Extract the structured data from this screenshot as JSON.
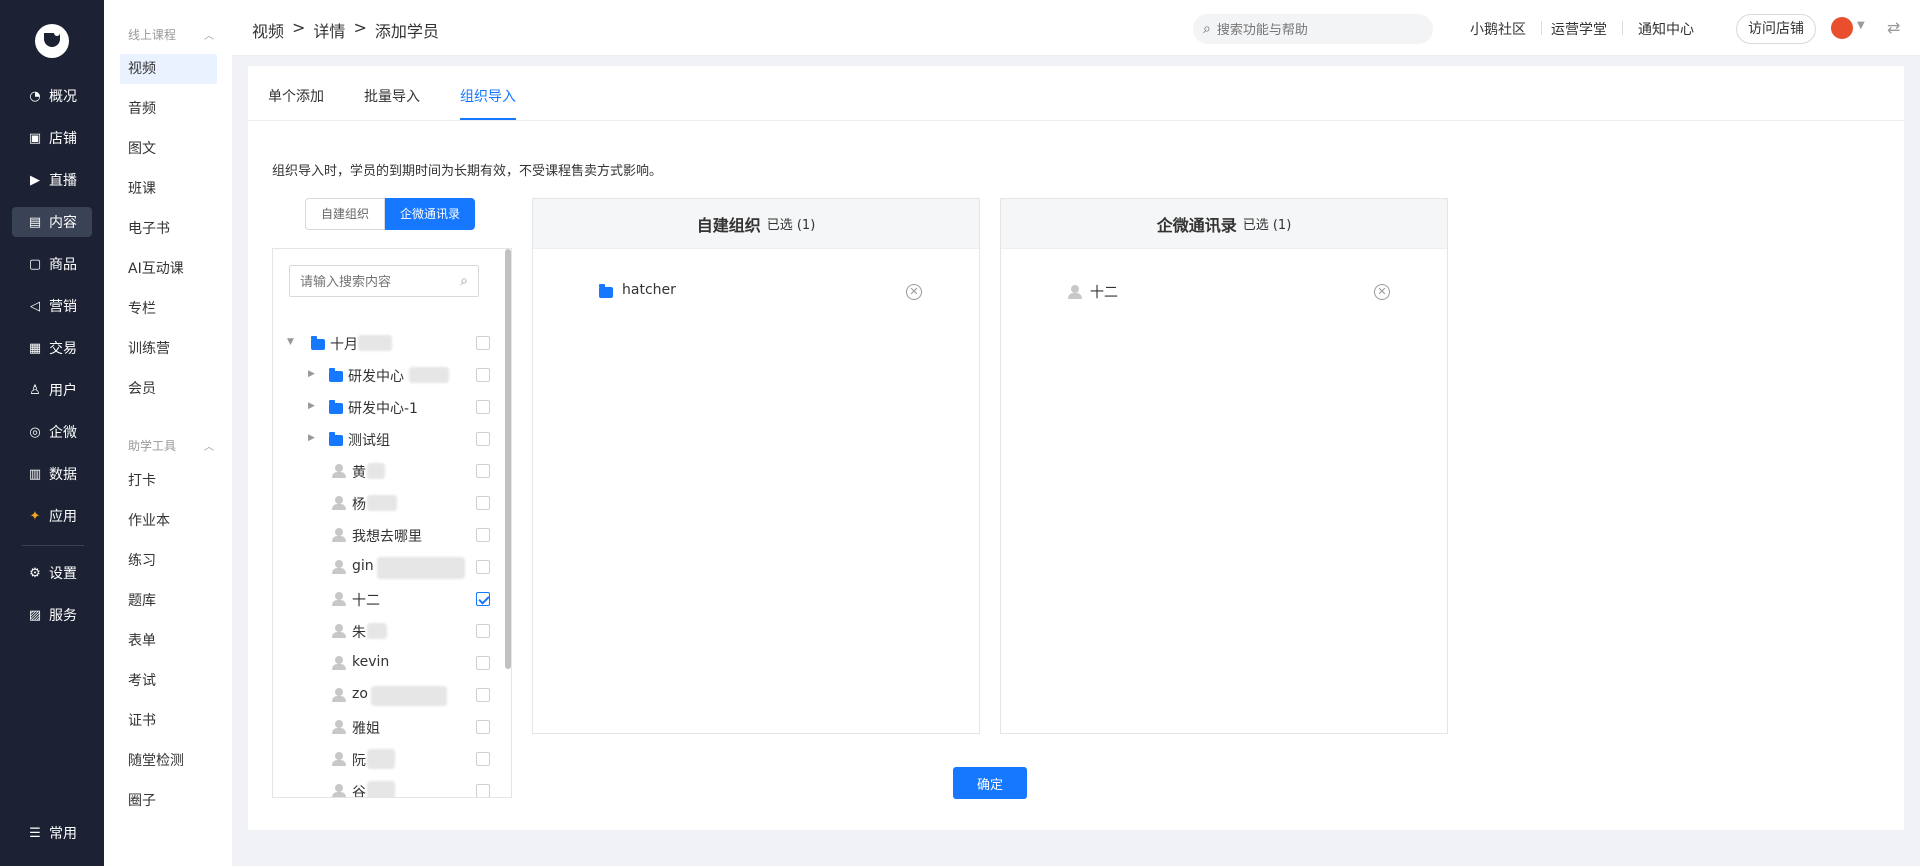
{
  "rail": {
    "items": [
      {
        "label": "概况",
        "icon": "dashboard-icon"
      },
      {
        "label": "店铺",
        "icon": "store-icon"
      },
      {
        "label": "直播",
        "icon": "live-icon"
      },
      {
        "label": "内容",
        "icon": "content-icon",
        "active": true
      },
      {
        "label": "商品",
        "icon": "goods-icon"
      },
      {
        "label": "营销",
        "icon": "marketing-icon"
      },
      {
        "label": "交易",
        "icon": "trade-icon"
      },
      {
        "label": "用户",
        "icon": "user-icon"
      },
      {
        "label": "企微",
        "icon": "wecom-icon"
      },
      {
        "label": "数据",
        "icon": "data-icon"
      },
      {
        "label": "应用",
        "icon": "apps-icon"
      },
      {
        "label": "设置",
        "icon": "settings-icon"
      },
      {
        "label": "服务",
        "icon": "service-icon"
      },
      {
        "label": "常用",
        "icon": "favorites-icon"
      }
    ]
  },
  "subnav": {
    "group1": "线上课程",
    "group1_items": [
      "视频",
      "音频",
      "图文",
      "班课",
      "电子书",
      "AI互动课",
      "专栏",
      "训练营",
      "会员"
    ],
    "group2": "助学工具",
    "group2_items": [
      "打卡",
      "作业本",
      "练习",
      "题库",
      "表单",
      "考试",
      "证书",
      "随堂检测",
      "圈子"
    ]
  },
  "topbar": {
    "breadcrumb": [
      "视频",
      ">",
      "详情",
      ">",
      "添加学员"
    ],
    "search_placeholder": "搜索功能与帮助",
    "links": [
      "小鹅社区",
      "运营学堂",
      "通知中心"
    ],
    "visit_store": "访问店铺"
  },
  "tabs": [
    "单个添加",
    "批量导入",
    "组织导入"
  ],
  "notice": "组织导入时，学员的到期时间为长期有效，不受课程售卖方式影响。",
  "segment": {
    "left": "自建组织",
    "right": "企微通讯录"
  },
  "tree": {
    "search_placeholder": "请输入搜索内容",
    "rows": [
      {
        "label": "十月",
        "type": "folder",
        "level": 0,
        "expanded": true,
        "checked": false
      },
      {
        "label": "研发中心",
        "type": "folder",
        "level": 1,
        "expanded": false,
        "checked": false
      },
      {
        "label": "研发中心-1",
        "type": "folder",
        "level": 1,
        "expanded": false,
        "checked": false
      },
      {
        "label": "测试组",
        "type": "folder",
        "level": 1,
        "expanded": false,
        "checked": false
      },
      {
        "label": "黄",
        "type": "person",
        "level": 1,
        "checked": false
      },
      {
        "label": "杨",
        "type": "person",
        "level": 1,
        "checked": false
      },
      {
        "label": "我想去哪里",
        "type": "person",
        "level": 1,
        "checked": false
      },
      {
        "label": "gin",
        "type": "person",
        "level": 1,
        "checked": false
      },
      {
        "label": "十二",
        "type": "person",
        "level": 1,
        "checked": true
      },
      {
        "label": "朱",
        "type": "person",
        "level": 1,
        "checked": false
      },
      {
        "label": "kevin",
        "type": "person",
        "level": 1,
        "checked": false
      },
      {
        "label": "zo",
        "type": "person",
        "level": 1,
        "checked": false
      },
      {
        "label": "雅姐",
        "type": "person",
        "level": 1,
        "checked": false
      },
      {
        "label": "阮",
        "type": "person",
        "level": 1,
        "checked": false
      },
      {
        "label": "谷",
        "type": "person",
        "level": 1,
        "checked": false
      }
    ]
  },
  "panels": [
    {
      "title": "自建组织",
      "count": "已选 (1)",
      "item": "hatcher",
      "item_type": "folder"
    },
    {
      "title": "企微通讯录",
      "count": "已选 (1)",
      "item": "十二",
      "item_type": "person"
    }
  ],
  "confirm": "确定",
  "colors": {
    "primary": "#1677ff",
    "rail_bg": "#1c2233"
  }
}
